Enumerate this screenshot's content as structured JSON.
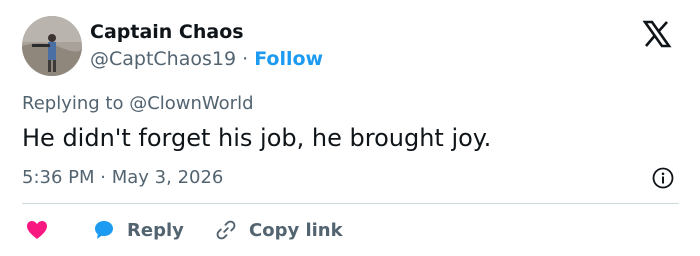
{
  "author": {
    "name": "Captain Chaos",
    "handle": "@CaptChaos19",
    "separator": "·",
    "follow_label": "Follow",
    "avatar_icon": "avatar-photo"
  },
  "brand": {
    "logo_icon": "x-logo-icon"
  },
  "tweet": {
    "replying_prefix": "Replying to",
    "replying_to": "@ClownWorld",
    "text": "He didn't forget his job, he brought joy.",
    "time": "5:36 PM",
    "separator": "·",
    "date": "May 3, 2026"
  },
  "actions": {
    "like_icon": "heart-icon",
    "reply_label": "Reply",
    "copy_label": "Copy link"
  },
  "colors": {
    "accent": "#1d9bf0",
    "like": "#f91880",
    "muted": "#536471",
    "text": "#0f1419",
    "divider": "#cfd9de"
  }
}
